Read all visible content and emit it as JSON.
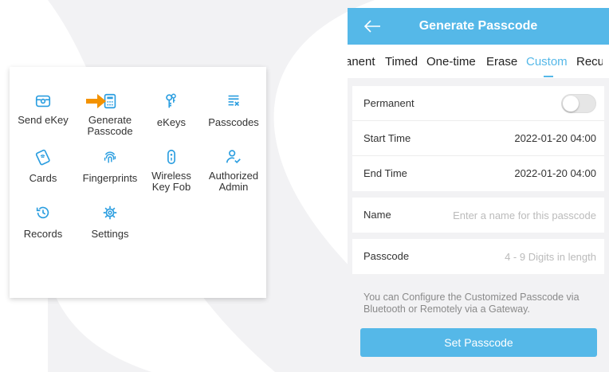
{
  "left_menu": {
    "items": [
      {
        "label": "Send eKey",
        "icon": "send-ekey-icon"
      },
      {
        "label": "Generate\nPasscode",
        "icon": "calculator-icon"
      },
      {
        "label": "eKeys",
        "icon": "keys-icon"
      },
      {
        "label": "Passcodes",
        "icon": "passcodes-list-icon"
      },
      {
        "label": "Cards",
        "icon": "card-icon"
      },
      {
        "label": "Fingerprints",
        "icon": "fingerprint-icon"
      },
      {
        "label": "Wireless\nKey Fob",
        "icon": "key-fob-icon"
      },
      {
        "label": "Authorized\nAdmin",
        "icon": "authorized-admin-icon"
      },
      {
        "label": "Records",
        "icon": "records-icon"
      },
      {
        "label": "Settings",
        "icon": "settings-icon"
      }
    ],
    "accent_color": "#2b9ee0",
    "pointer_color": "#f39200"
  },
  "screen": {
    "title": "Generate Passcode",
    "header_color": "#55b8e8",
    "tabs": [
      {
        "label": "anent"
      },
      {
        "label": "Timed"
      },
      {
        "label": "One-time"
      },
      {
        "label": "Erase"
      },
      {
        "label": "Custom",
        "active": true
      },
      {
        "label": "Recu"
      }
    ],
    "permanent_label": "Permanent",
    "permanent_enabled": false,
    "start_time_label": "Start Time",
    "start_time_value": "2022-01-20 04:00",
    "end_time_label": "End Time",
    "end_time_value": "2022-01-20 04:00",
    "name_label": "Name",
    "name_placeholder": "Enter a name for this passcode",
    "passcode_label": "Passcode",
    "passcode_placeholder": "4 - 9 Digits in length",
    "note": "You can Configure the Customized Passcode via Bluetooth or Remotely via a Gateway.",
    "set_button": "Set Passcode"
  }
}
